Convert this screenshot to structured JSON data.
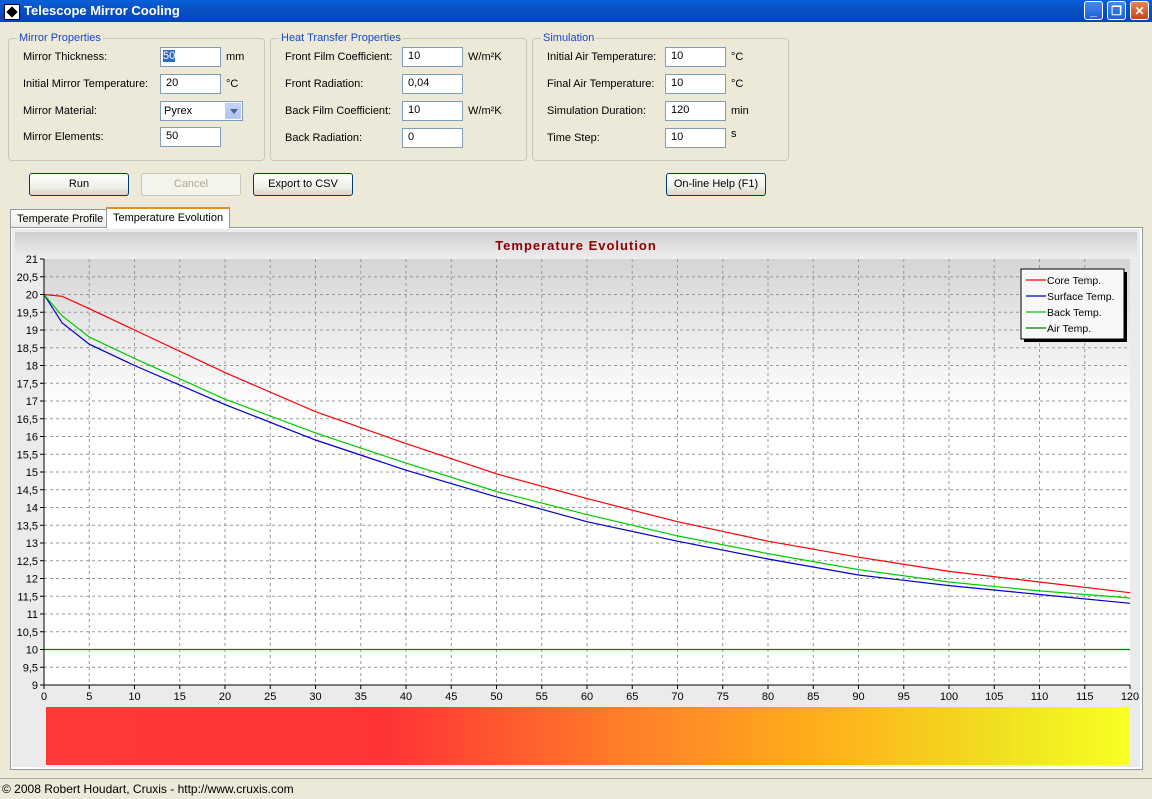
{
  "window": {
    "title": "Telescope Mirror Cooling"
  },
  "mirror": {
    "legend": "Mirror Properties",
    "thickness_label": "Mirror Thickness:",
    "thickness_value": "50",
    "thickness_unit": "mm",
    "init_temp_label": "Initial Mirror Temperature:",
    "init_temp_value": "20",
    "init_temp_unit": "°C",
    "material_label": "Mirror Material:",
    "material_value": "Pyrex",
    "elements_label": "Mirror Elements:",
    "elements_value": "50"
  },
  "heat": {
    "legend": "Heat Transfer Properties",
    "front_film_label": "Front Film Coefficient:",
    "front_film_value": "10",
    "front_film_unit": "W/m²K",
    "front_rad_label": "Front Radiation:",
    "front_rad_value": "0,04",
    "back_film_label": "Back Film Coefficient:",
    "back_film_value": "10",
    "back_film_unit": "W/m²K",
    "back_rad_label": "Back Radiation:",
    "back_rad_value": "0"
  },
  "sim": {
    "legend": "Simulation",
    "init_air_label": "Initial Air Temperature:",
    "init_air_value": "10",
    "init_air_unit": "°C",
    "final_air_label": "Final Air Temperature:",
    "final_air_value": "10",
    "final_air_unit": "°C",
    "duration_label": "Simulation Duration:",
    "duration_value": "120",
    "duration_unit": "min",
    "step_label": "Time Step:",
    "step_value": "10",
    "step_unit": "s"
  },
  "buttons": {
    "run": "Run",
    "cancel": "Cancel",
    "export": "Export to CSV",
    "help": "On-line Help (F1)"
  },
  "tabs": [
    "Temperate Profile",
    "Temperature Evolution"
  ],
  "status": "© 2008 Robert Houdart, Cruxis  -  http://www.cruxis.com",
  "chart_data": {
    "type": "line",
    "title": "Temperature Evolution",
    "xlim": [
      0,
      120
    ],
    "ylim": [
      9,
      21
    ],
    "x_ticks": [
      "0",
      "5",
      "10",
      "15",
      "20",
      "25",
      "30",
      "35",
      "40",
      "45",
      "50",
      "55",
      "60",
      "65",
      "70",
      "75",
      "80",
      "85",
      "90",
      "95",
      "100",
      "105",
      "110",
      "115",
      "120"
    ],
    "y_ticks": [
      "21",
      "20,5",
      "20",
      "19,5",
      "19",
      "18,5",
      "18",
      "17,5",
      "17",
      "16,5",
      "16",
      "15,5",
      "15",
      "14,5",
      "14",
      "13,5",
      "13",
      "12,5",
      "12",
      "11,5",
      "11",
      "10,5",
      "10",
      "9,5",
      "9"
    ],
    "grid": true,
    "legend_position": "top-right",
    "x": [
      0,
      2,
      5,
      10,
      20,
      30,
      40,
      50,
      60,
      70,
      80,
      90,
      100,
      110,
      120
    ],
    "series": [
      {
        "name": "Core Temp.",
        "color": "#FF0000",
        "values": [
          20.0,
          19.95,
          19.6,
          19.0,
          17.8,
          16.7,
          15.8,
          14.95,
          14.25,
          13.6,
          13.05,
          12.6,
          12.2,
          11.9,
          11.6
        ]
      },
      {
        "name": "Surface Temp.",
        "color": "#0000CC",
        "values": [
          20.0,
          19.2,
          18.6,
          18.0,
          16.9,
          15.9,
          15.05,
          14.3,
          13.6,
          13.05,
          12.55,
          12.1,
          11.8,
          11.55,
          11.3
        ]
      },
      {
        "name": "Back Temp.",
        "color": "#00CC00",
        "values": [
          20.0,
          19.4,
          18.8,
          18.2,
          17.05,
          16.1,
          15.25,
          14.45,
          13.8,
          13.2,
          12.7,
          12.25,
          11.9,
          11.65,
          11.45
        ]
      },
      {
        "name": "Air Temp.",
        "color": "#008000",
        "values": [
          10,
          10,
          10,
          10,
          10,
          10,
          10,
          10,
          10,
          10,
          10,
          10,
          10,
          10,
          10
        ]
      }
    ]
  }
}
